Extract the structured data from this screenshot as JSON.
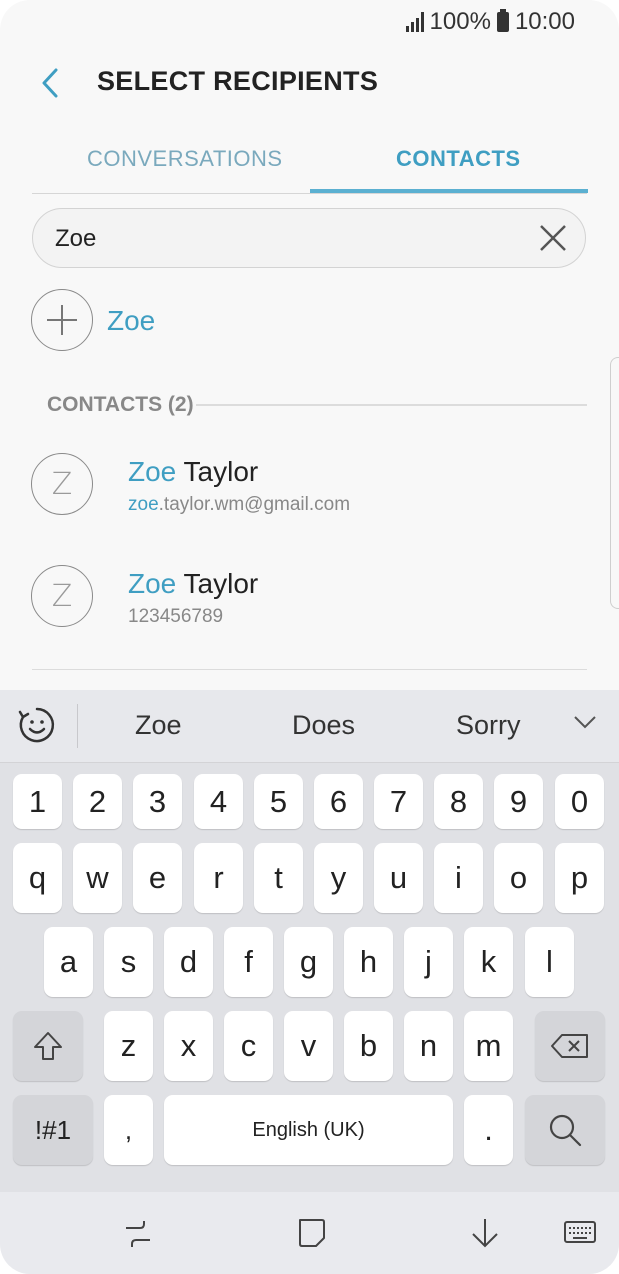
{
  "status_bar": {
    "battery": "100%",
    "time": "10:00"
  },
  "header": {
    "title": "SELECT RECIPIENTS"
  },
  "tabs": [
    {
      "label": "CONVERSATIONS",
      "selected": false
    },
    {
      "label": "CONTACTS",
      "selected": true
    }
  ],
  "search": {
    "value": "Zoe"
  },
  "add_recipient": {
    "label": "Zoe"
  },
  "section": {
    "label": "CONTACTS (2)"
  },
  "contacts": [
    {
      "initial": "Z",
      "name_match": "Zoe",
      "name_rest": " Taylor",
      "sub_match": "zoe",
      "sub_rest": ".taylor.wm@gmail.com"
    },
    {
      "initial": "Z",
      "name_match": "Zoe",
      "name_rest": " Taylor",
      "sub_match": "",
      "sub_rest": "123456789"
    }
  ],
  "keyboard": {
    "suggestions": [
      "Zoe",
      "Does",
      "Sorry"
    ],
    "row_numbers": [
      "1",
      "2",
      "3",
      "4",
      "5",
      "6",
      "7",
      "8",
      "9",
      "0"
    ],
    "row1": [
      "q",
      "w",
      "e",
      "r",
      "t",
      "y",
      "u",
      "i",
      "o",
      "p"
    ],
    "row2": [
      "a",
      "s",
      "d",
      "f",
      "g",
      "h",
      "j",
      "k",
      "l"
    ],
    "row3": [
      "z",
      "x",
      "c",
      "v",
      "b",
      "n",
      "m"
    ],
    "symbols_key": "!#1",
    "comma_key": ",",
    "space_label": "English (UK)",
    "period_key": "."
  },
  "colors": {
    "accent": "#3f9ec2",
    "indicator": "#5bb0d1",
    "keyboard_bg": "#e0e1e5"
  }
}
